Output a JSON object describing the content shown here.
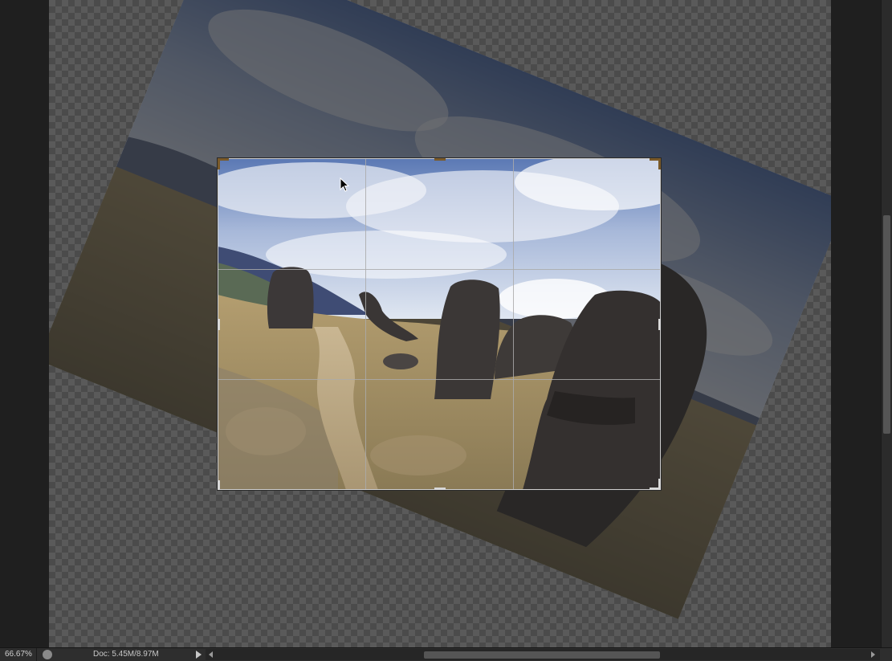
{
  "status": {
    "zoom": "66.67%",
    "doc_info": "Doc: 5.45M/8.97M"
  },
  "colors": {
    "canvas_checker_dark": "#4b4b4b",
    "canvas_checker_light": "#5a5a5a",
    "workspace": "#1e1e1e",
    "crop_handle": "#7a5a2a"
  },
  "icons": {
    "status_icon": "photoshop-status-icon",
    "play": "play-arrow-icon",
    "cursor": "arrow-cursor-icon"
  }
}
